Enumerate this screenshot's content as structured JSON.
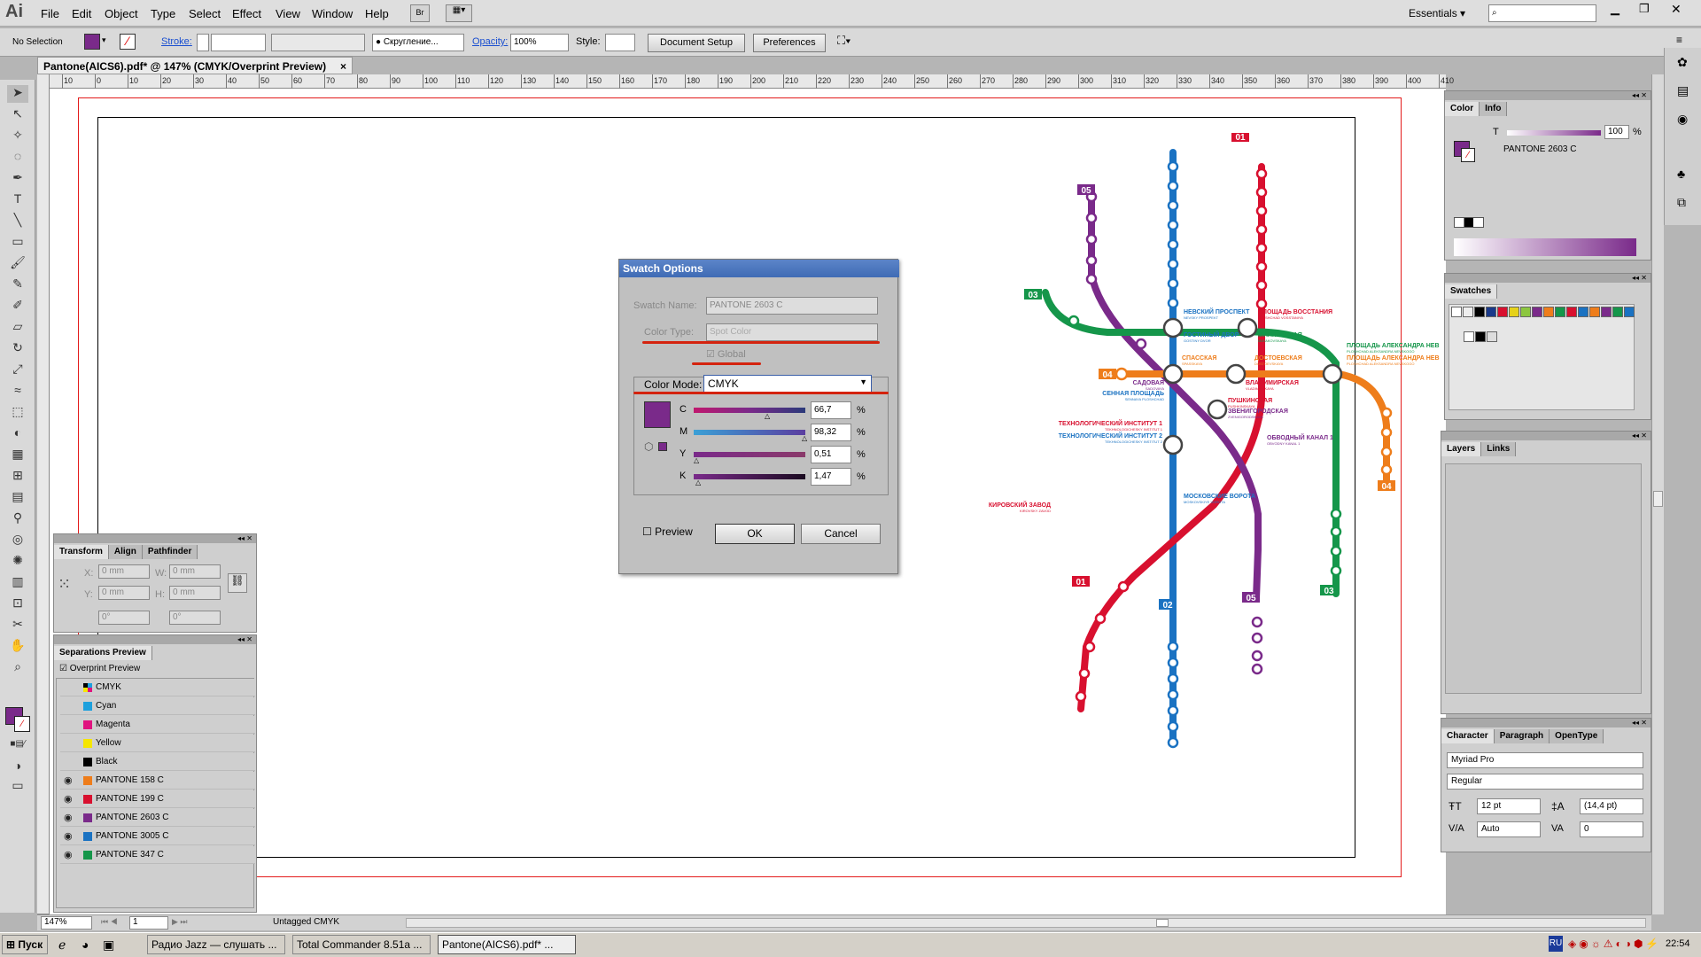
{
  "app": {
    "logo": "Ai"
  },
  "menu": [
    "File",
    "Edit",
    "Object",
    "Type",
    "Select",
    "Effect",
    "View",
    "Window",
    "Help"
  ],
  "menu_bridge": "Br",
  "workspace": {
    "label": "Essentials",
    "search_placeholder": ""
  },
  "control": {
    "selection": "No Selection",
    "stroke_label": "Stroke:",
    "brush": "Скругление...",
    "opacity_label": "Opacity:",
    "opacity": "100%",
    "style_label": "Style:",
    "doc_setup": "Document Setup",
    "preferences": "Preferences"
  },
  "document": {
    "tab": "Pantone(AICS6).pdf* @ 147% (CMYK/Overprint Preview)"
  },
  "ruler": [
    "10",
    "0",
    "10",
    "20",
    "30",
    "40",
    "50",
    "60",
    "70",
    "80",
    "90",
    "100",
    "110",
    "120",
    "130",
    "140",
    "150",
    "160",
    "170",
    "180",
    "190",
    "200",
    "210",
    "220",
    "230",
    "240",
    "250",
    "260",
    "270",
    "280",
    "290",
    "300",
    "310",
    "320",
    "330",
    "340",
    "350",
    "360",
    "370",
    "380",
    "390",
    "400",
    "410"
  ],
  "swatch_dialog": {
    "title": "Swatch Options",
    "name_label": "Swatch Name:",
    "name": "PANTONE 2603 C",
    "type_label": "Color Type:",
    "type": "Spot Color",
    "global": "Global",
    "mode_label": "Color Mode:",
    "mode": "CMYK",
    "c_label": "C",
    "c": "66,7",
    "m_label": "M",
    "m": "98,32",
    "y_label": "Y",
    "y": "0,51",
    "k_label": "K",
    "k": "1,47",
    "pct": "%",
    "preview": "Preview",
    "ok": "OK",
    "cancel": "Cancel",
    "swatch_color": "#7a2a8a"
  },
  "transform": {
    "tabs": [
      "Transform",
      "Align",
      "Pathfinder"
    ],
    "x_label": "X:",
    "x": "0 mm",
    "y_label": "Y:",
    "y": "0 mm",
    "w_label": "W:",
    "w": "0 mm",
    "h_label": "H:",
    "h": "0 mm",
    "rot": "0°",
    "shear": "0°"
  },
  "separations": {
    "title": "Separations Preview",
    "overprint": "Overprint Preview",
    "items": [
      {
        "name": "CMYK",
        "color": "#000000"
      },
      {
        "name": "Cyan",
        "color": "#1da0dd"
      },
      {
        "name": "Magenta",
        "color": "#e0137f"
      },
      {
        "name": "Yellow",
        "color": "#f5e600"
      },
      {
        "name": "Black",
        "color": "#000000"
      },
      {
        "name": "PANTONE 158 C",
        "color": "#ee7d1b"
      },
      {
        "name": "PANTONE 199 C",
        "color": "#d8102f"
      },
      {
        "name": "PANTONE 2603 C",
        "color": "#7a2a8a"
      },
      {
        "name": "PANTONE 3005 C",
        "color": "#1a72c2"
      },
      {
        "name": "PANTONE 347 C",
        "color": "#15964a"
      }
    ]
  },
  "color_panel": {
    "tabs": [
      "Color",
      "Info"
    ],
    "t_label": "T",
    "t": "100",
    "pct": "%",
    "name": "PANTONE 2603 C"
  },
  "swatches_panel": {
    "title": "Swatches"
  },
  "layers_panel": {
    "tabs": [
      "Layers",
      "Links"
    ]
  },
  "character": {
    "tabs": [
      "Character",
      "Paragraph",
      "OpenType"
    ],
    "font": "Myriad Pro",
    "style": "Regular",
    "size": "12 pt",
    "leading": "(14,4 pt)",
    "kerning": "Auto",
    "tracking": "0"
  },
  "status": {
    "zoom": "147%",
    "page": "1",
    "profile": "Untagged CMYK"
  },
  "metro": {
    "lines": [
      "02",
      "01",
      "05",
      "03",
      "04"
    ],
    "labels": {
      "nevsky": "НЕВСКИЙ ПРОСПЕКТ",
      "nevsky_en": "NEVSKY PROSPEKT",
      "vosst": "ПЛОЩАДЬ ВОССТАНИЯ",
      "vosst_en": "PLOSHCHAD VOSSTANIYA",
      "gost": "ГОСТИНЫЙ ДВОР",
      "gost_en": "GOSTINY DVOR",
      "mayak": "МАЯКОВСКАЯ",
      "mayak_en": "MAYAKOVSKAYA",
      "alex1": "ПЛОЩАДЬ АЛЕКСАНДРА НЕВ",
      "alex1_en": "PLOSHCHAD ALEKSANDRA NEVSKOGO",
      "alex2": "ПЛОЩАДЬ АЛЕКСАНДРА НЕВ",
      "alex2_en": "PLOSHCHAD ALEKSANDRA NEVSKOGO",
      "spas": "СПАССКАЯ",
      "spas_en": "SPASSKAYA",
      "dost": "ДОСТОЕВСКАЯ",
      "dost_en": "DOSTOEVSKAYA",
      "sad": "САДОВАЯ",
      "sad_en": "SADOVAYA",
      "senn": "СЕННАЯ ПЛОЩАДЬ",
      "senn_en": "SENNAYA PLOSHCHAD",
      "vlad": "ВЛАДИМИРСКАЯ",
      "vlad_en": "VLADIMIRSKAYA",
      "push": "ПУШКИНСКАЯ",
      "push_en": "PUSHKINSKAYA",
      "zven": "ЗВЕНИГОРОДСКАЯ",
      "zven_en": "ZVENIGORODSKAYA",
      "tech1": "ТЕХНОЛОГИЧЕСКИЙ ИНСТИТУТ 1",
      "tech1_en": "TEKHNOLOGICHESKY INSTITUT 1",
      "tech2": "ТЕХНОЛОГИЧЕСКИЙ ИНСТИТУТ 2",
      "tech2_en": "TEKHNOLOGICHESKY INSTITUT 2",
      "obv": "ОБВОДНЫЙ КАНАЛ 1",
      "obv_en": "OBVODNY KANAL 1",
      "kirov": "КИРОВСКИЙ ЗАВОД",
      "kirov_en": "KIROVSKY ZAVOD",
      "mosk": "МОСКОВСКИЕ ВОРОТА",
      "mosk_en": "MOSKOVSKIYE VOROTA"
    }
  },
  "taskbar": {
    "start": "Пуск",
    "tasks": [
      "Радио Jazz — слушать ...",
      "Total Commander 8.51a ...",
      "Pantone(AICS6).pdf* ..."
    ],
    "lang": "RU",
    "time": "22:54"
  },
  "colors": {
    "blue": "#1a72c2",
    "red": "#d8102f",
    "purple": "#7a2a8a",
    "green": "#15964a",
    "orange": "#ee7d1b"
  }
}
